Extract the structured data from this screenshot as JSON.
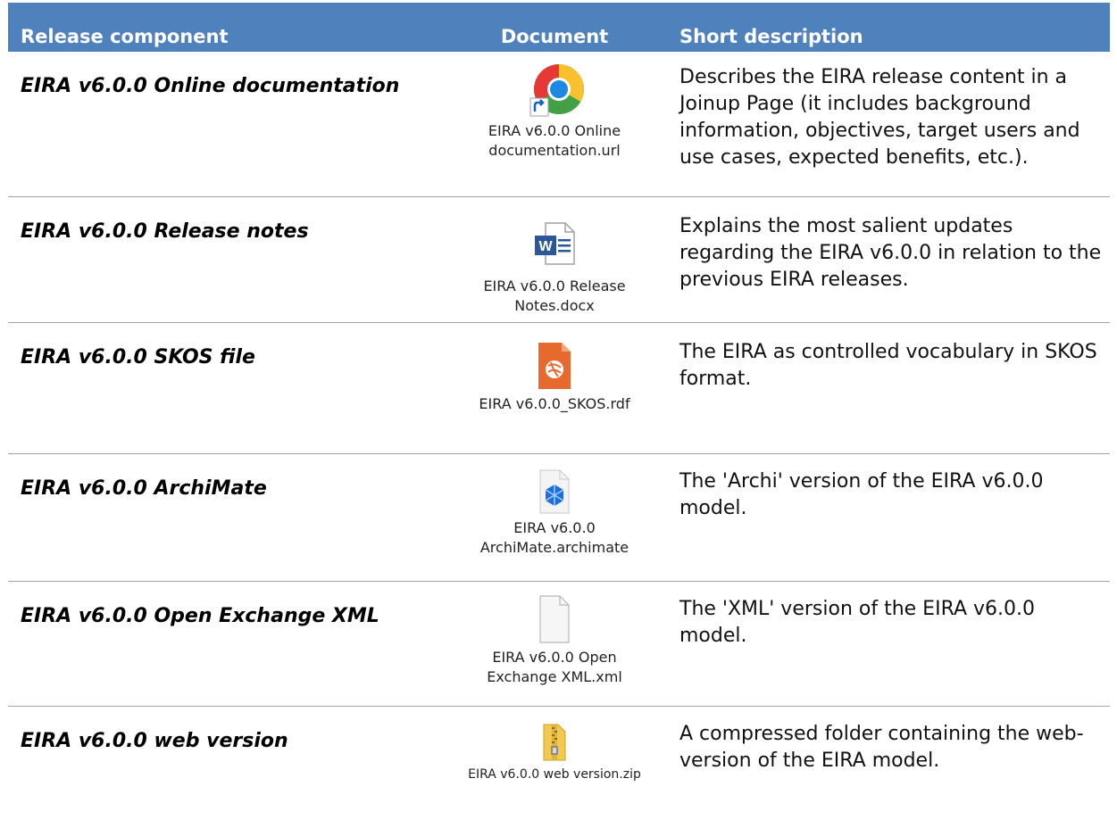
{
  "table": {
    "headers": {
      "component": "Release component",
      "document": "Document",
      "description": "Short description"
    },
    "rows": [
      {
        "component": "EIRA v6.0.0 Online documentation",
        "file_name": "EIRA v6.0.0 Online documentation.url",
        "icon": "chrome-shortcut-icon",
        "description": "Describes the EIRA release content in a Joinup Page (it includes background information, objectives, target users and use cases, expected benefits, etc.)."
      },
      {
        "component": "EIRA v6.0.0 Release notes",
        "file_name": "EIRA v6.0.0 Release Notes.docx",
        "icon": "word-document-icon",
        "description": "Explains the most salient updates regarding the EIRA v6.0.0 in relation to the previous EIRA releases."
      },
      {
        "component": "EIRA v6.0.0 SKOS file",
        "file_name": "EIRA v6.0.0_SKOS.rdf",
        "icon": "rdf-file-icon",
        "description": "The EIRA as controlled vocabulary in SKOS format."
      },
      {
        "component": "EIRA v6.0.0 ArchiMate",
        "file_name": "EIRA v6.0.0 ArchiMate.archimate",
        "icon": "archimate-file-icon",
        "description": "The 'Archi' version of the EIRA v6.0.0 model."
      },
      {
        "component": "EIRA v6.0.0 Open Exchange XML",
        "file_name": "EIRA v6.0.0 Open Exchange XML.xml",
        "icon": "blank-file-icon",
        "description": "The 'XML' version of the EIRA v6.0.0 model."
      },
      {
        "component": "EIRA v6.0.0 web version",
        "file_name": "EIRA v6.0.0 web version.zip",
        "icon": "zip-folder-icon",
        "description": "A compressed folder containing the web-version of the EIRA model."
      }
    ]
  },
  "colors": {
    "header_background": "#4f81bd",
    "header_text": "#ffffff",
    "row_border": "#9aa6b8"
  }
}
